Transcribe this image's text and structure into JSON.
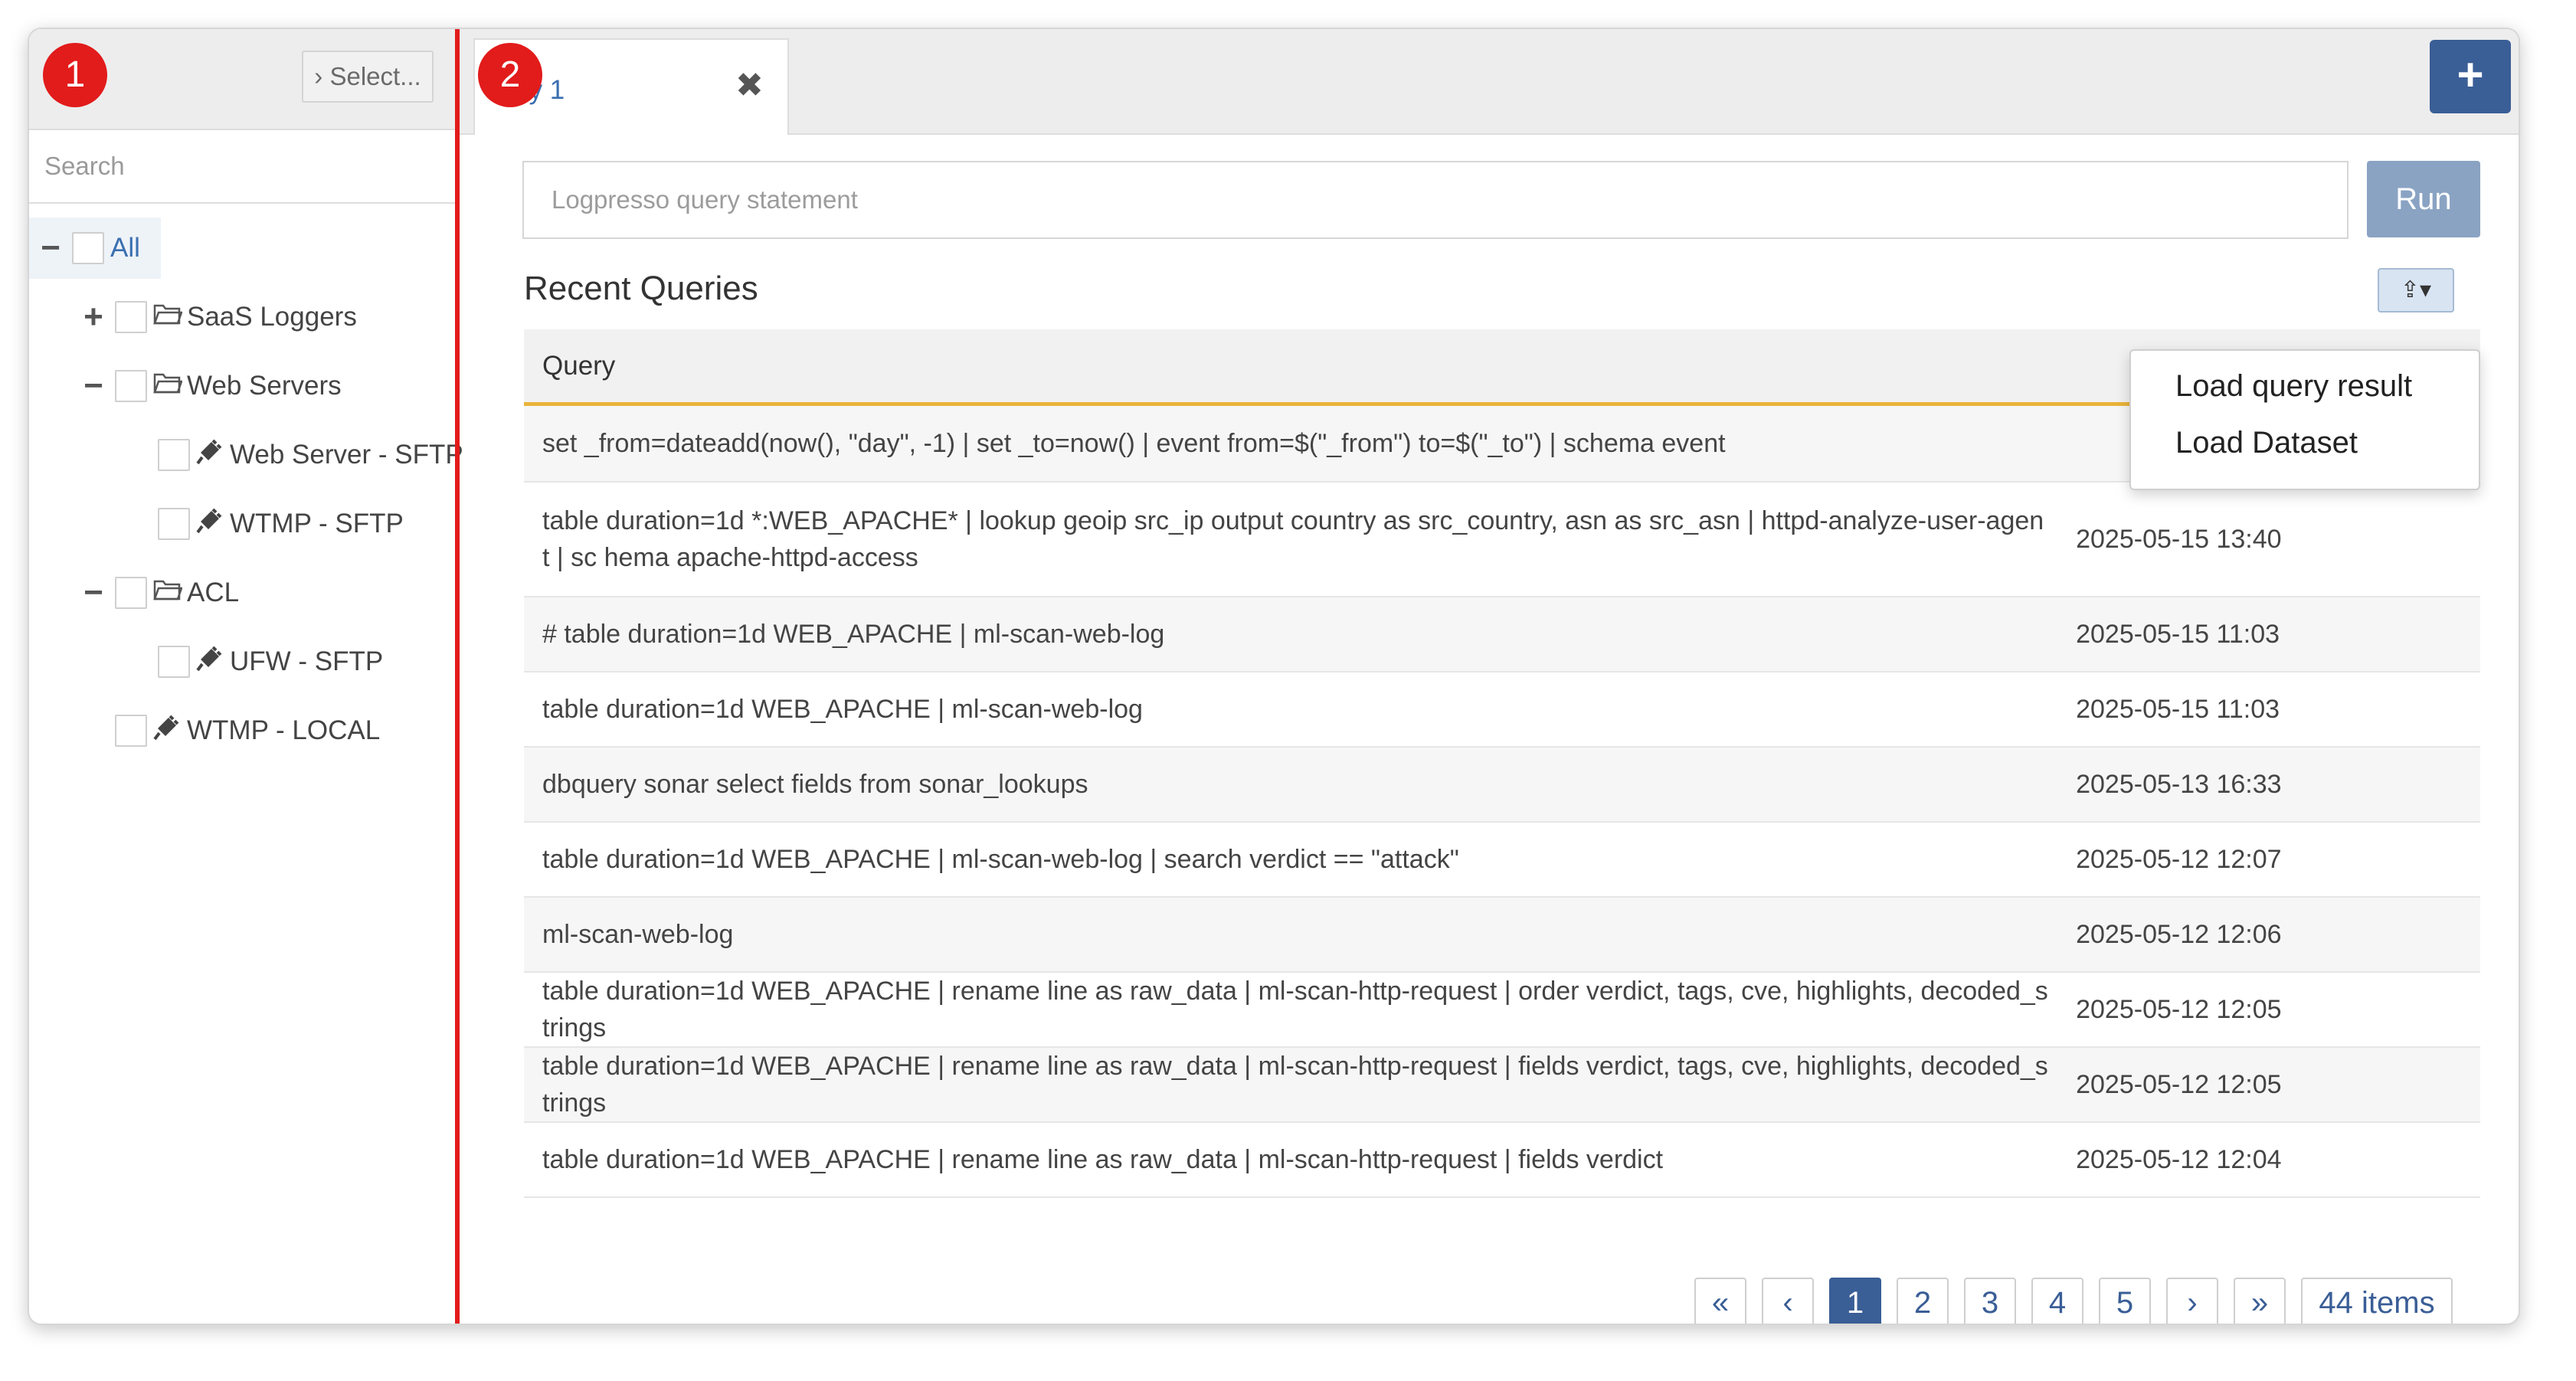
{
  "badges": [
    "1",
    "2"
  ],
  "left_panel": {
    "select_label": "› Select...",
    "search_placeholder": "Search",
    "tree": {
      "all": {
        "toggle": "−",
        "label": "All"
      },
      "saas_loggers": {
        "toggle": "+",
        "label": "SaaS Loggers"
      },
      "web_servers": {
        "toggle": "−",
        "label": "Web Servers"
      },
      "web_server_sftp": {
        "label": "Web Server - SFTP"
      },
      "wtmp_sftp": {
        "label": "WTMP - SFTP"
      },
      "acl": {
        "toggle": "−",
        "label": "ACL"
      },
      "ufw_sftp": {
        "label": "UFW - SFTP"
      },
      "wtmp_local": {
        "label": "WTMP - LOCAL"
      }
    }
  },
  "tab": {
    "label": "uery 1",
    "close": "✖"
  },
  "add_button": "+",
  "query_input": {
    "placeholder": "Logpresso query statement"
  },
  "run_label": "Run",
  "recent_title": "Recent Queries",
  "export_button": "⇪▾",
  "table": {
    "header": "Query",
    "rows": [
      {
        "query": "set _from=dateadd(now(), \"day\", -1) | set _to=now() | event from=$(\"_from\") to=$(\"_to\") | schema event",
        "time": ""
      },
      {
        "query": "table duration=1d *:WEB_APACHE* | lookup geoip src_ip output country as src_country, asn as src_asn | httpd-analyze-user-agent | sc hema apache-httpd-access",
        "time": "2025-05-15 13:40"
      },
      {
        "query": "# table duration=1d WEB_APACHE | ml-scan-web-log",
        "time": "2025-05-15 11:03"
      },
      {
        "query": "table duration=1d WEB_APACHE | ml-scan-web-log",
        "time": "2025-05-15 11:03"
      },
      {
        "query": "dbquery sonar select fields from sonar_lookups",
        "time": "2025-05-13 16:33"
      },
      {
        "query": "table duration=1d WEB_APACHE | ml-scan-web-log | search verdict == \"attack\"",
        "time": "2025-05-12 12:07"
      },
      {
        "query": "ml-scan-web-log",
        "time": "2025-05-12 12:06"
      },
      {
        "query": "table duration=1d WEB_APACHE | rename line as raw_data | ml-scan-http-request | order verdict, tags, cve, highlights, decoded_strings",
        "time": "2025-05-12 12:05"
      },
      {
        "query": "table duration=1d WEB_APACHE | rename line as raw_data | ml-scan-http-request | fields verdict, tags, cve, highlights, decoded_strings",
        "time": "2025-05-12 12:05"
      },
      {
        "query": "table duration=1d WEB_APACHE | rename line as raw_data | ml-scan-http-request | fields verdict",
        "time": "2025-05-12 12:04"
      }
    ]
  },
  "dropdown": {
    "items": [
      "Load query result",
      "Load Dataset"
    ]
  },
  "pagination": {
    "first": "«",
    "prev": "‹",
    "pages": [
      "1",
      "2",
      "3",
      "4",
      "5"
    ],
    "active_page": "1",
    "next": "›",
    "last": "»",
    "total": "44 items"
  },
  "colors": {
    "accent": "#3a5e96",
    "badge": "#e21b1b",
    "header_underline": "#e8b43a"
  }
}
